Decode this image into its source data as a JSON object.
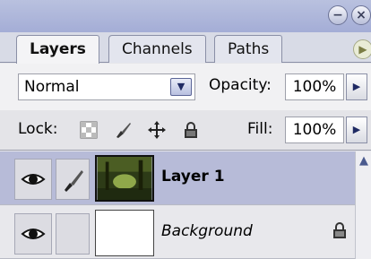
{
  "tabs": [
    {
      "label": "Layers",
      "active": true
    },
    {
      "label": "Channels",
      "active": false
    },
    {
      "label": "Paths",
      "active": false
    }
  ],
  "blend_mode": "Normal",
  "opacity": {
    "label": "Opacity:",
    "value": "100%"
  },
  "lock": {
    "label": "Lock:"
  },
  "fill": {
    "label": "Fill:",
    "value": "100%"
  },
  "layers": [
    {
      "name": "Layer 1",
      "selected": true
    },
    {
      "name": "Background",
      "locked": true
    }
  ],
  "colors": {
    "titlebar": "#a4add6",
    "selected_row": "#b7bbd8",
    "accent_button": "#1f2a63"
  },
  "icons": {
    "title_buttons": [
      "minimize-icon",
      "close-icon"
    ],
    "tab_more": "menu-arrow-icon",
    "lock_buttons": [
      "lock-transparency-icon",
      "lock-image-pixels-icon",
      "lock-position-icon",
      "lock-all-icon"
    ],
    "row_icons": [
      "eye-icon",
      "brush-icon",
      "lock-icon"
    ]
  }
}
